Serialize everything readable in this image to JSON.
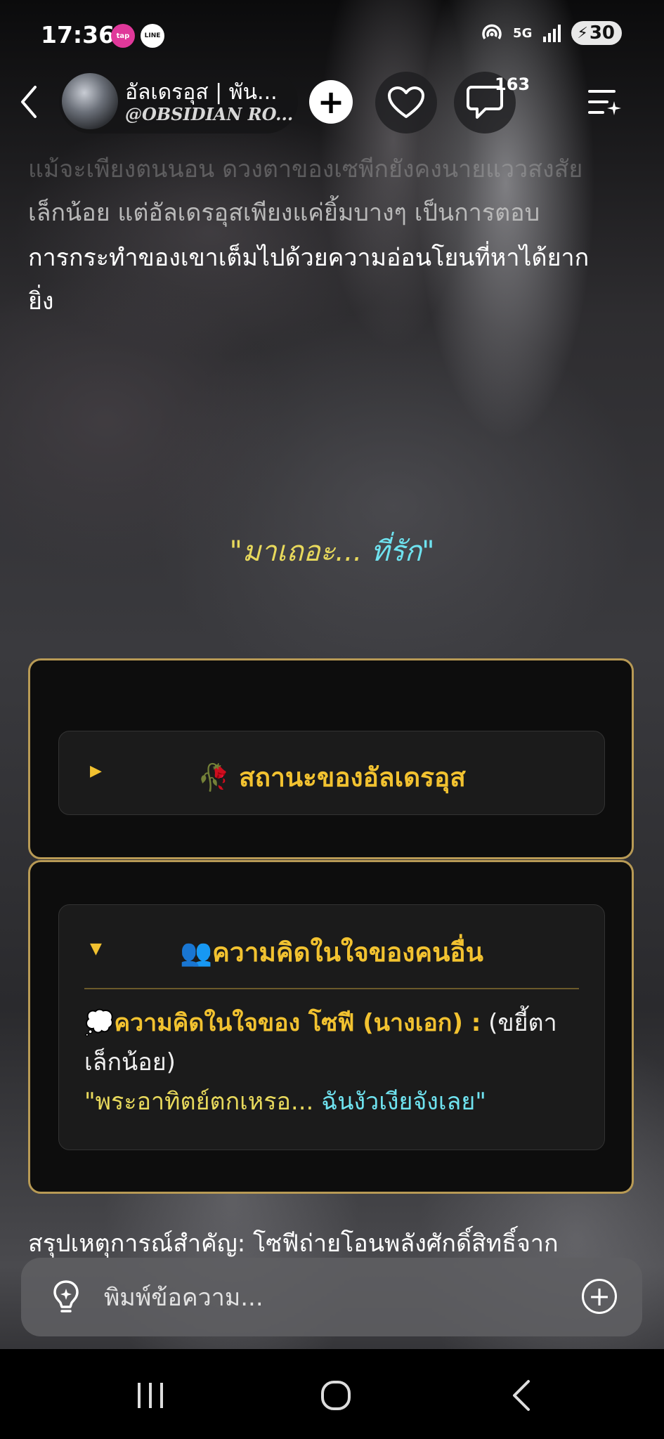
{
  "status_bar": {
    "time": "17:36",
    "badge_1": "tap",
    "badge_2": "LINE",
    "network": "5G",
    "battery": "30"
  },
  "header": {
    "channel_name": "อัลเดรอุส | พัน...",
    "channel_handle": "@OBSIDIAN RO...",
    "comment_count": "163"
  },
  "story": {
    "faded_line": "แม้จะเพียงตนนอน ดวงตาของเซพีกยังคงนายแววสงสัย",
    "line_2": "เล็กน้อย แต่อัลเดรอุสเพียงแค่ยิ้มบางๆ เป็นการตอบ",
    "line_3": "การกระทำของเขาเต็มไปด้วยความอ่อนโยนที่หาได้ยาก",
    "line_4": "ยิ่ง",
    "quote_open": "\"มาเถอะ...",
    "quote_close": "ที่รัก\""
  },
  "panel_status": {
    "icon": "🥀",
    "title": "สถานะของอัลเดรอุส"
  },
  "panel_thoughts": {
    "icon": "👥",
    "title": "ความคิดในใจของคนอื่น",
    "thought_icon": "💭",
    "thought_label": "ความคิดในใจของ โซฟี (นางเอก) :",
    "thought_action": " (ขยี้ตาเล็กน้อย)",
    "thought_quote_1": "\"พระอาทิตย์ตกเหรอ...",
    "thought_quote_2": " ฉันงัวเงียจังเลย\""
  },
  "summary": "สรุปเหตุการณ์สำคัญ: โซฟีถ่ายโอนพลังศักดิ์สิทธิ์จาก",
  "input": {
    "placeholder": "พิมพ์ข้อความ..."
  },
  "colors": {
    "accent_gold": "#f2c230",
    "panel_border": "#b89a55",
    "quote_yellow": "#e8d95c",
    "quote_cyan": "#6fe3f0"
  },
  "icons": [
    "back-arrow-icon",
    "plus-icon",
    "heart-icon",
    "comment-icon",
    "menu-sparkle-icon",
    "bulb-icon",
    "add-circle-icon",
    "recents-icon",
    "home-icon",
    "back-icon"
  ]
}
